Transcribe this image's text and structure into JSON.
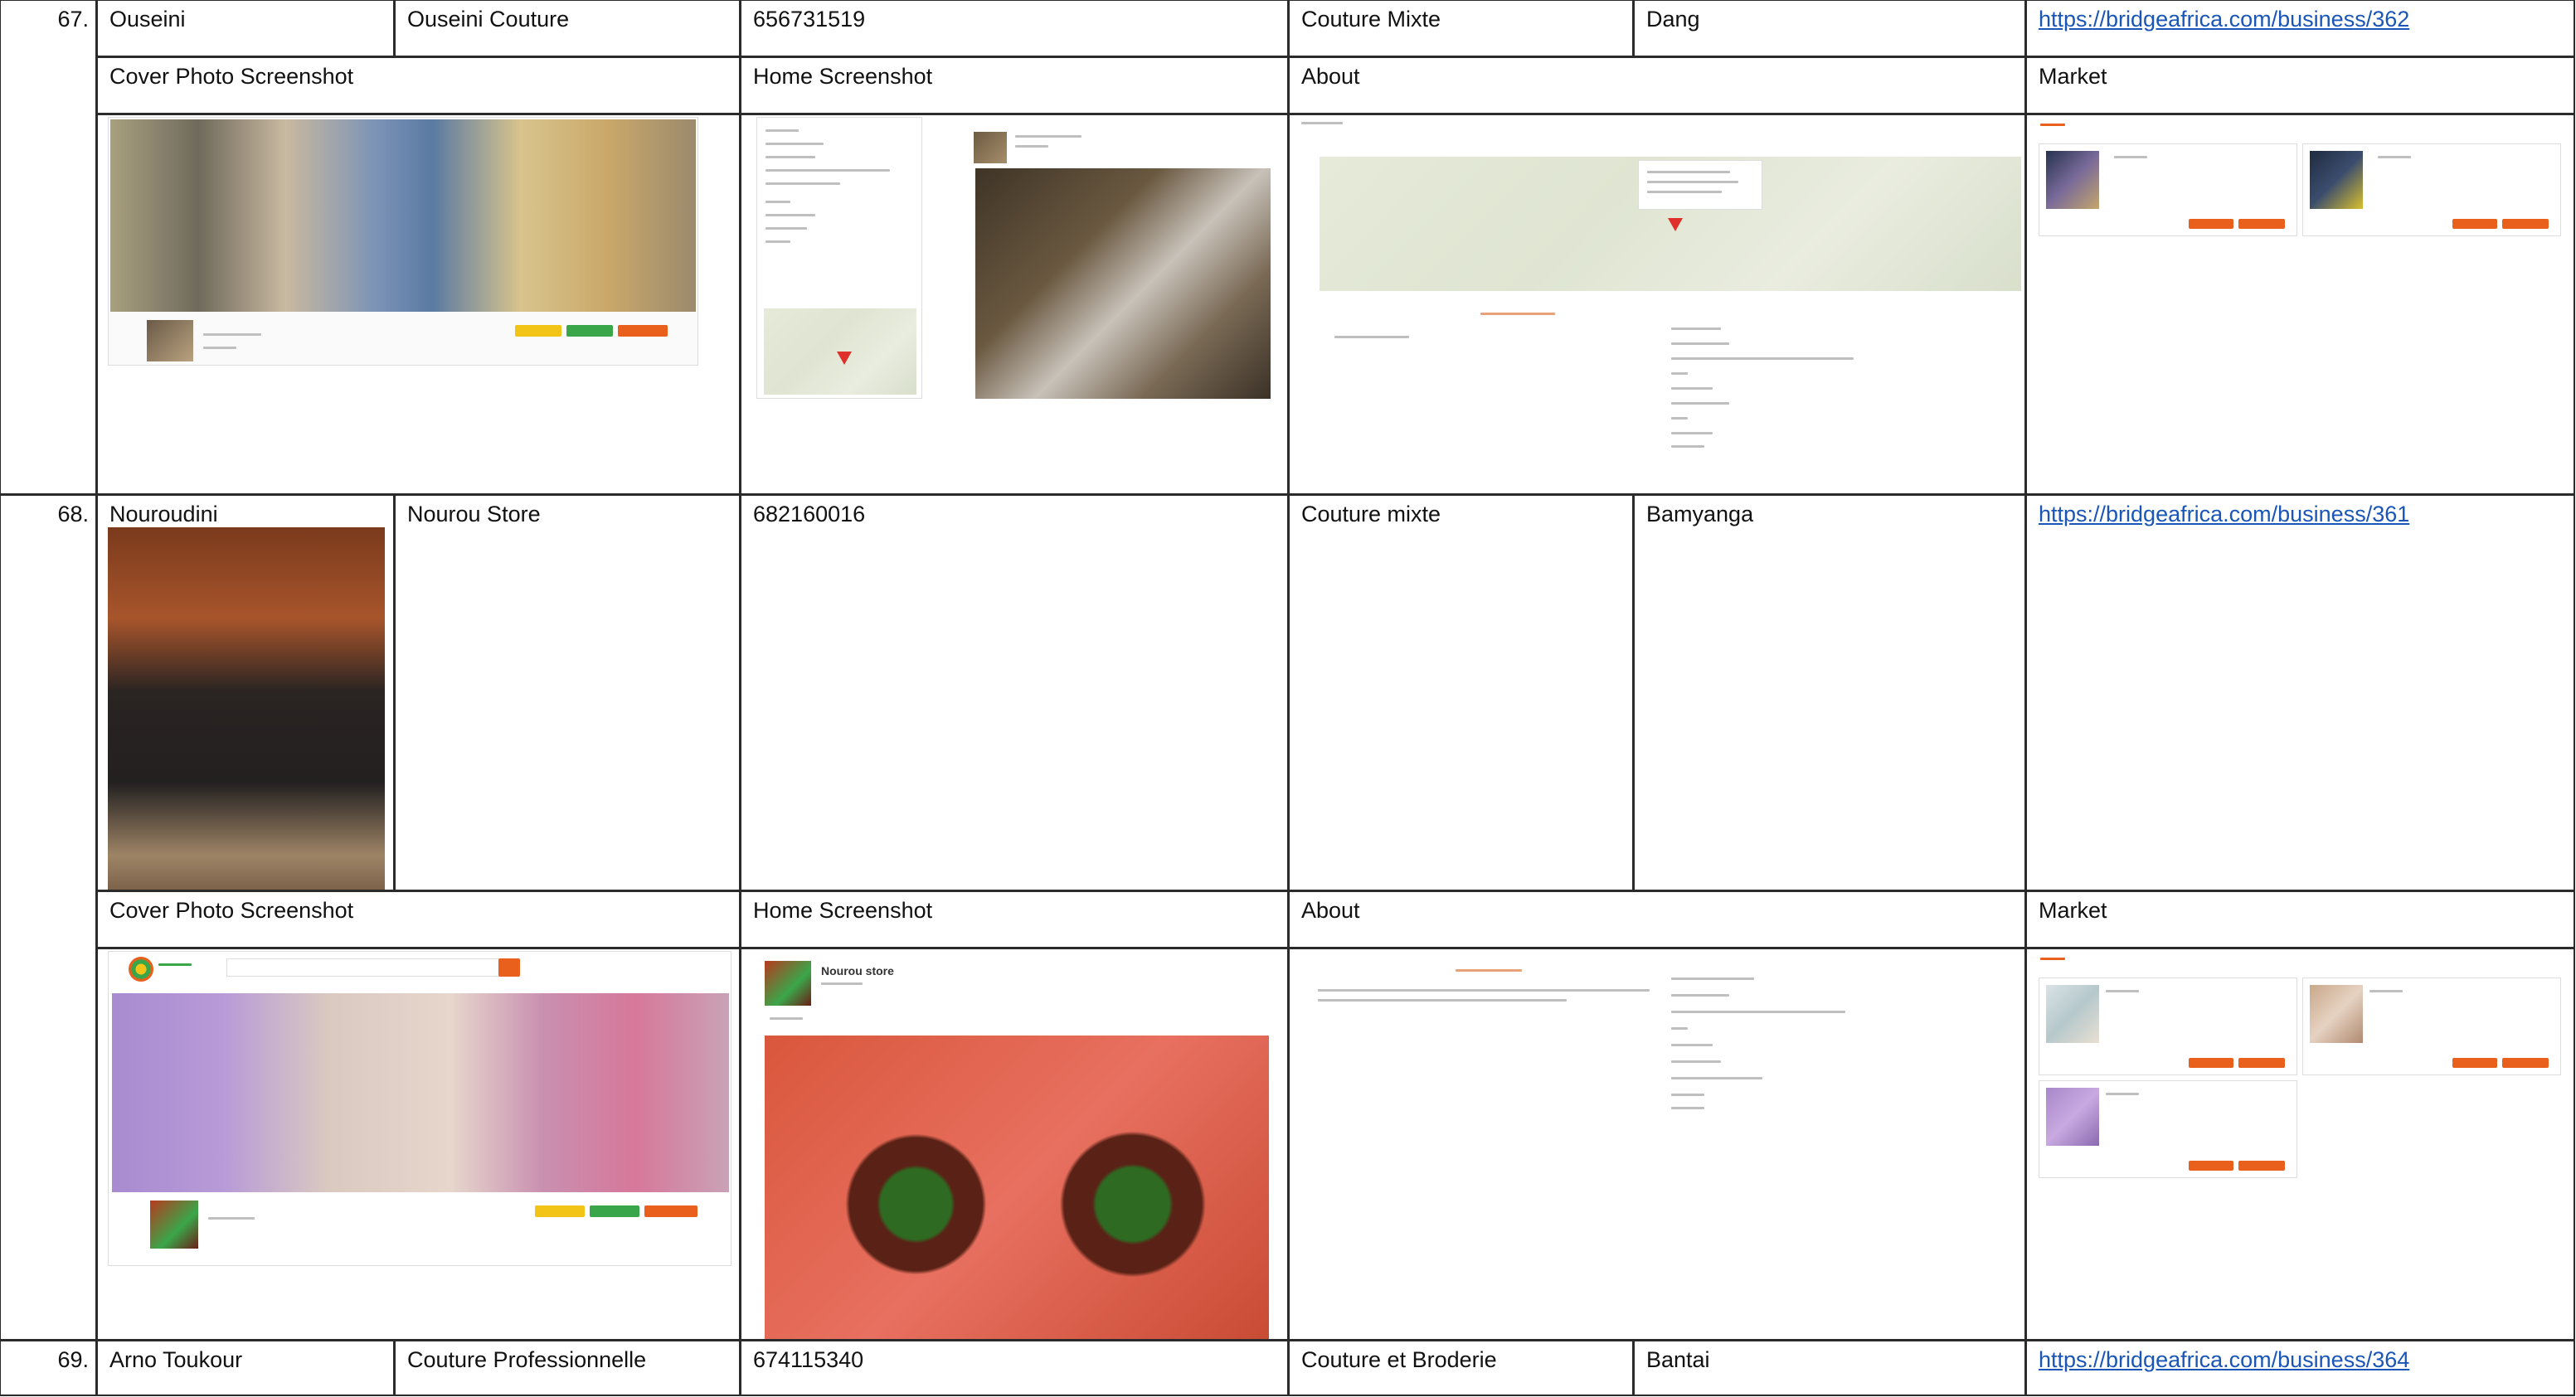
{
  "rows": [
    {
      "number": "67.",
      "owner": "Ouseini",
      "business": "Ouseini Couture",
      "phone": "656731519",
      "category": "Couture Mixte",
      "location": "Dang",
      "url": "https://bridgeafrica.com/business/362"
    },
    {
      "number": "68.",
      "owner": "Nouroudini",
      "business": "Nourou Store",
      "phone": "682160016",
      "category": "Couture mixte",
      "location": "Bamyanga",
      "url": "https://bridgeafrica.com/business/361"
    },
    {
      "number": "69.",
      "owner": "Arno Toukour",
      "business": "Couture Professionnelle",
      "phone": "674115340",
      "category": "Couture et Broderie",
      "location": "Bantai",
      "url": "https://bridgeafrica.com/business/364"
    }
  ],
  "section_headers": {
    "cover": "Cover Photo Screenshot",
    "home": "Home Screenshot",
    "about": "About",
    "market": "Market"
  },
  "screenshots": {
    "row68_home_title": "Nourou store"
  },
  "colors": {
    "border": "#2b2b2b",
    "link": "#1a56b8",
    "accent_orange": "#e8601c",
    "accent_green": "#3aa64a",
    "accent_yellow": "#f2c418",
    "map_pin": "#e0302b"
  }
}
